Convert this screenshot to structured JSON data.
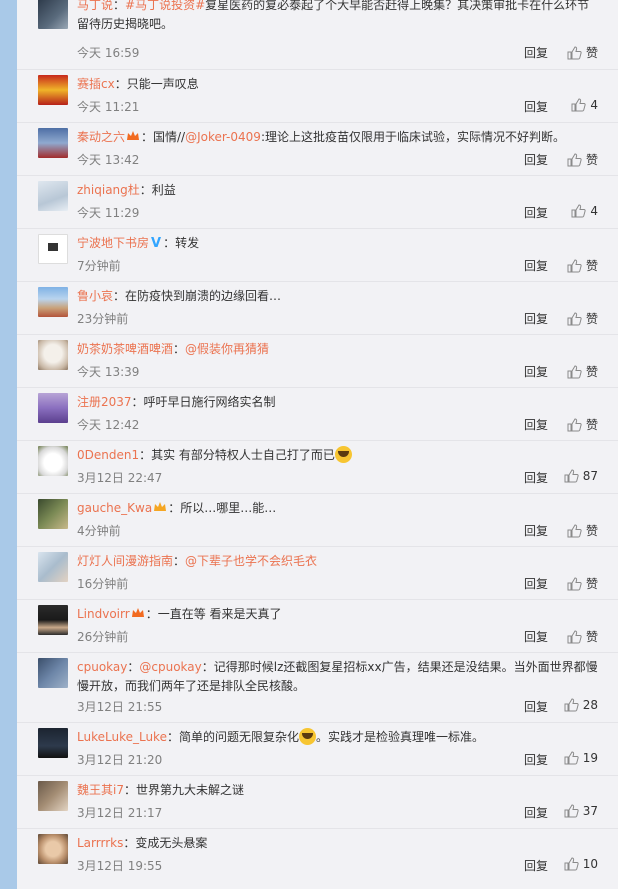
{
  "comments": [
    {
      "username": "马丁说",
      "topic": "#马丁说投资#",
      "text": "复星医药的复必泰起了个大早能否赶得上晚集？其决策审批卡在什么环节留待历史揭晓吧。",
      "time": "今天 16:59",
      "reply": "回复",
      "likes": "赞"
    },
    {
      "username": "赛插cx",
      "text": "：只能一声叹息",
      "time": "今天 11:21",
      "reply": "回复",
      "likes": "4"
    },
    {
      "username": "秦动之六",
      "text_prefix": "：国情//",
      "mention": "@Joker-0409",
      "text": ":理论上这批疫苗仅限用于临床试验，实际情况不好判断。",
      "time": "今天 13:42",
      "reply": "回复",
      "likes": "赞"
    },
    {
      "username": "zhiqiang杜",
      "text": "：利益",
      "time": "今天 11:29",
      "reply": "回复",
      "likes": "4"
    },
    {
      "username": "宁波地下书房",
      "badge": "V",
      "text": "：转发",
      "time": "7分钟前",
      "reply": "回复",
      "likes": "赞"
    },
    {
      "username": "鲁小哀",
      "text": "：在防疫快到崩溃的边缘回看…",
      "time": "23分钟前",
      "reply": "回复",
      "likes": "赞"
    },
    {
      "username": "奶茶奶茶啤酒啤酒",
      "text_prefix": "：",
      "mention": "@假装你再猜猜",
      "text": "",
      "time": "今天 13:39",
      "reply": "回复",
      "likes": "赞"
    },
    {
      "username": "注册2037",
      "text": "：呼吁早日施行网络实名制",
      "time": "今天 12:42",
      "reply": "回复",
      "likes": "赞"
    },
    {
      "username": "0Denden1",
      "text": "：其实 有部分特权人士自己打了而已",
      "time": "3月12日 22:47",
      "reply": "回复",
      "likes": "87"
    },
    {
      "username": "gauche_Kwa",
      "text": "：所以…哪里…能…",
      "time": "4分钟前",
      "reply": "回复",
      "likes": "赞"
    },
    {
      "username": "灯灯人间漫游指南",
      "text_prefix": "：",
      "mention": "@下辈子也学不会织毛衣",
      "text": "",
      "time": "16分钟前",
      "reply": "回复",
      "likes": "赞"
    },
    {
      "username": "Lindvoirr",
      "text": "：一直在等 看来是天真了",
      "time": "26分钟前",
      "reply": "回复",
      "likes": "赞"
    },
    {
      "username": "cpuokay",
      "text_prefix": "：",
      "mention": "@cpuokay",
      "text": "：记得那时候lz还截图复星招标xx广告，结果还是没结果。当外面世界都慢慢开放，而我们两年了还是排队全民核酸。",
      "time": "3月12日 21:55",
      "reply": "回复",
      "likes": "28"
    },
    {
      "username": "LukeLuke_Luke",
      "text": "：简单的问题无限复杂化",
      "text_after": "。实践才是检验真理唯一标准。",
      "time": "3月12日 21:20",
      "reply": "回复",
      "likes": "19"
    },
    {
      "username": "魏王其i7",
      "text": "：世界第九大未解之谜",
      "time": "3月12日 21:17",
      "reply": "回复",
      "likes": "37"
    },
    {
      "username": "Larrrrks",
      "text": "：变成无头悬案",
      "time": "3月12日 19:55",
      "reply": "回复",
      "likes": "10"
    }
  ]
}
